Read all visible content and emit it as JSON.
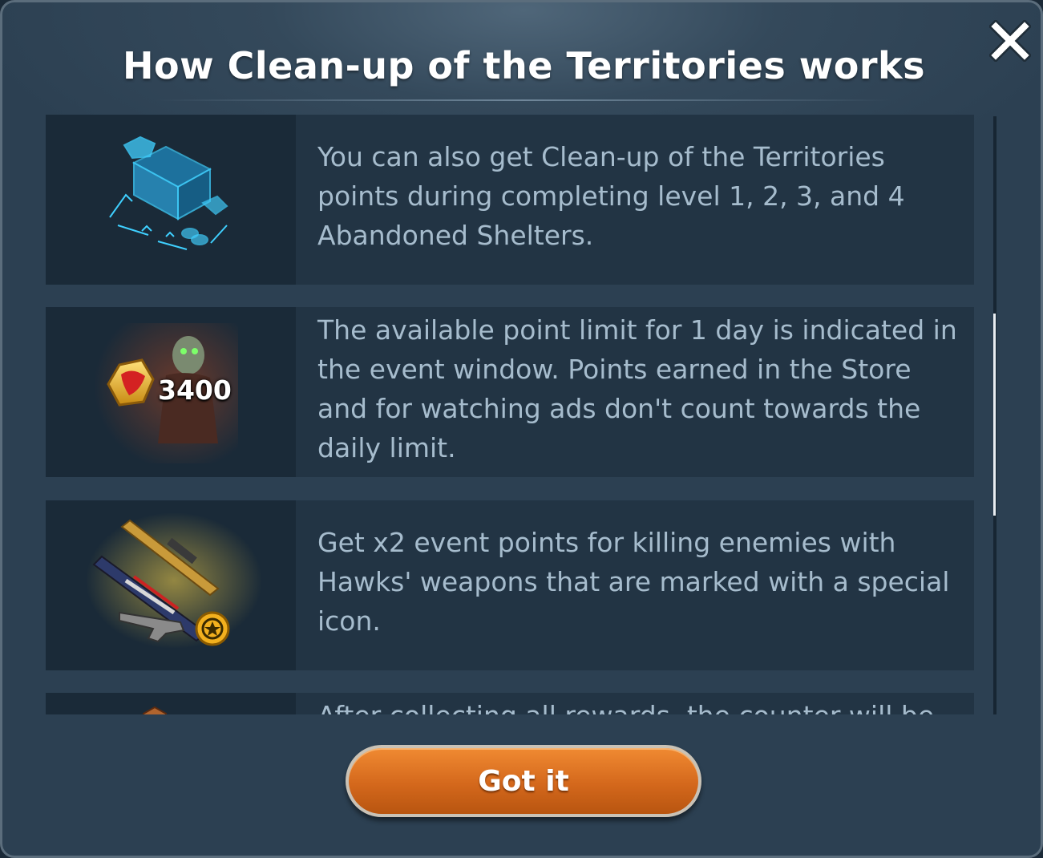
{
  "dialog": {
    "title": "How Clean-up of the Territories works",
    "close_icon": "close-icon",
    "items": [
      {
        "icon": "shelter-hologram-icon",
        "text": "You can also get Clean-up of the Territories points during completing level 1, 2, 3, and 4 Abandoned Shelters."
      },
      {
        "icon": "zombie-points-icon",
        "badge": "3400",
        "text": "The available point limit for 1 day is indicated in the event window. Points earned in the Store and for watching ads don't count towards the daily limit."
      },
      {
        "icon": "hawks-weapons-icon",
        "text": "Get x2 event points for killing enemies with Hawks' weapons that are marked with a special icon."
      },
      {
        "icon": "reward-chest-icon",
        "text": "After collecting all rewards, the counter will be"
      }
    ],
    "button_label": "Got it"
  },
  "colors": {
    "accent_button": "#d4681c",
    "row_background": "#223444",
    "text": "#a6bccd"
  }
}
